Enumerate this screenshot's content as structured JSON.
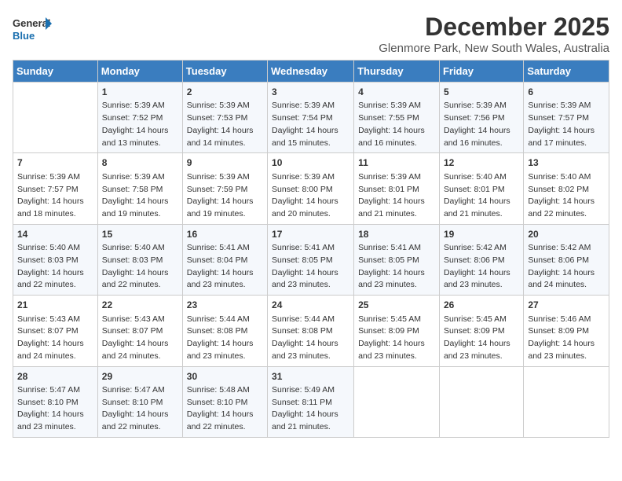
{
  "logo": {
    "line1": "General",
    "line2": "Blue"
  },
  "title": "December 2025",
  "subtitle": "Glenmore Park, New South Wales, Australia",
  "days_of_week": [
    "Sunday",
    "Monday",
    "Tuesday",
    "Wednesday",
    "Thursday",
    "Friday",
    "Saturday"
  ],
  "weeks": [
    [
      {
        "day": "",
        "content": ""
      },
      {
        "day": "1",
        "content": "Sunrise: 5:39 AM\nSunset: 7:52 PM\nDaylight: 14 hours\nand 13 minutes."
      },
      {
        "day": "2",
        "content": "Sunrise: 5:39 AM\nSunset: 7:53 PM\nDaylight: 14 hours\nand 14 minutes."
      },
      {
        "day": "3",
        "content": "Sunrise: 5:39 AM\nSunset: 7:54 PM\nDaylight: 14 hours\nand 15 minutes."
      },
      {
        "day": "4",
        "content": "Sunrise: 5:39 AM\nSunset: 7:55 PM\nDaylight: 14 hours\nand 16 minutes."
      },
      {
        "day": "5",
        "content": "Sunrise: 5:39 AM\nSunset: 7:56 PM\nDaylight: 14 hours\nand 16 minutes."
      },
      {
        "day": "6",
        "content": "Sunrise: 5:39 AM\nSunset: 7:57 PM\nDaylight: 14 hours\nand 17 minutes."
      }
    ],
    [
      {
        "day": "7",
        "content": "Sunrise: 5:39 AM\nSunset: 7:57 PM\nDaylight: 14 hours\nand 18 minutes."
      },
      {
        "day": "8",
        "content": "Sunrise: 5:39 AM\nSunset: 7:58 PM\nDaylight: 14 hours\nand 19 minutes."
      },
      {
        "day": "9",
        "content": "Sunrise: 5:39 AM\nSunset: 7:59 PM\nDaylight: 14 hours\nand 19 minutes."
      },
      {
        "day": "10",
        "content": "Sunrise: 5:39 AM\nSunset: 8:00 PM\nDaylight: 14 hours\nand 20 minutes."
      },
      {
        "day": "11",
        "content": "Sunrise: 5:39 AM\nSunset: 8:01 PM\nDaylight: 14 hours\nand 21 minutes."
      },
      {
        "day": "12",
        "content": "Sunrise: 5:40 AM\nSunset: 8:01 PM\nDaylight: 14 hours\nand 21 minutes."
      },
      {
        "day": "13",
        "content": "Sunrise: 5:40 AM\nSunset: 8:02 PM\nDaylight: 14 hours\nand 22 minutes."
      }
    ],
    [
      {
        "day": "14",
        "content": "Sunrise: 5:40 AM\nSunset: 8:03 PM\nDaylight: 14 hours\nand 22 minutes."
      },
      {
        "day": "15",
        "content": "Sunrise: 5:40 AM\nSunset: 8:03 PM\nDaylight: 14 hours\nand 22 minutes."
      },
      {
        "day": "16",
        "content": "Sunrise: 5:41 AM\nSunset: 8:04 PM\nDaylight: 14 hours\nand 23 minutes."
      },
      {
        "day": "17",
        "content": "Sunrise: 5:41 AM\nSunset: 8:05 PM\nDaylight: 14 hours\nand 23 minutes."
      },
      {
        "day": "18",
        "content": "Sunrise: 5:41 AM\nSunset: 8:05 PM\nDaylight: 14 hours\nand 23 minutes."
      },
      {
        "day": "19",
        "content": "Sunrise: 5:42 AM\nSunset: 8:06 PM\nDaylight: 14 hours\nand 23 minutes."
      },
      {
        "day": "20",
        "content": "Sunrise: 5:42 AM\nSunset: 8:06 PM\nDaylight: 14 hours\nand 24 minutes."
      }
    ],
    [
      {
        "day": "21",
        "content": "Sunrise: 5:43 AM\nSunset: 8:07 PM\nDaylight: 14 hours\nand 24 minutes."
      },
      {
        "day": "22",
        "content": "Sunrise: 5:43 AM\nSunset: 8:07 PM\nDaylight: 14 hours\nand 24 minutes."
      },
      {
        "day": "23",
        "content": "Sunrise: 5:44 AM\nSunset: 8:08 PM\nDaylight: 14 hours\nand 23 minutes."
      },
      {
        "day": "24",
        "content": "Sunrise: 5:44 AM\nSunset: 8:08 PM\nDaylight: 14 hours\nand 23 minutes."
      },
      {
        "day": "25",
        "content": "Sunrise: 5:45 AM\nSunset: 8:09 PM\nDaylight: 14 hours\nand 23 minutes."
      },
      {
        "day": "26",
        "content": "Sunrise: 5:45 AM\nSunset: 8:09 PM\nDaylight: 14 hours\nand 23 minutes."
      },
      {
        "day": "27",
        "content": "Sunrise: 5:46 AM\nSunset: 8:09 PM\nDaylight: 14 hours\nand 23 minutes."
      }
    ],
    [
      {
        "day": "28",
        "content": "Sunrise: 5:47 AM\nSunset: 8:10 PM\nDaylight: 14 hours\nand 23 minutes."
      },
      {
        "day": "29",
        "content": "Sunrise: 5:47 AM\nSunset: 8:10 PM\nDaylight: 14 hours\nand 22 minutes."
      },
      {
        "day": "30",
        "content": "Sunrise: 5:48 AM\nSunset: 8:10 PM\nDaylight: 14 hours\nand 22 minutes."
      },
      {
        "day": "31",
        "content": "Sunrise: 5:49 AM\nSunset: 8:11 PM\nDaylight: 14 hours\nand 21 minutes."
      },
      {
        "day": "",
        "content": ""
      },
      {
        "day": "",
        "content": ""
      },
      {
        "day": "",
        "content": ""
      }
    ]
  ]
}
